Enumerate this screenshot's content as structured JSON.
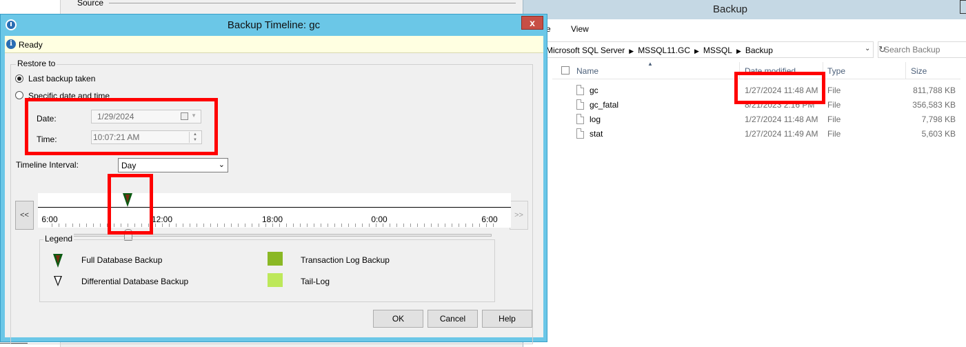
{
  "background_window": {
    "source_label": "Source"
  },
  "explorer": {
    "title": "Backup",
    "ribbon": {
      "partial_tab": "e",
      "view_tab": "View"
    },
    "breadcrumbs": [
      "Microsoft SQL Server",
      "MSSQL11.GC",
      "MSSQL",
      "Backup"
    ],
    "search_placeholder": "Search Backup",
    "columns": {
      "name": "Name",
      "date": "Date modified",
      "type": "Type",
      "size": "Size"
    },
    "files": [
      {
        "name": "gc",
        "date": "1/27/2024 11:48 AM",
        "type": "File",
        "size": "811,788 KB"
      },
      {
        "name": "gc_fatal",
        "date": "8/21/2023 2:16 PM",
        "type": "File",
        "size": "356,583 KB"
      },
      {
        "name": "log",
        "date": "1/27/2024 11:48 AM",
        "type": "File",
        "size": "7,798 KB"
      },
      {
        "name": "stat",
        "date": "1/27/2024 11:49 AM",
        "type": "File",
        "size": "5,603 KB"
      }
    ]
  },
  "dialog": {
    "title": "Backup Timeline: gc",
    "close_label": "x",
    "status": "Ready",
    "restore_to": {
      "label": "Restore to",
      "option_last": "Last backup taken",
      "option_specific": "Specific date and time",
      "selected": "last",
      "date_label": "Date:",
      "date_value": "1/29/2024",
      "time_label": "Time:",
      "time_value": "10:07:21 AM"
    },
    "interval": {
      "label": "Timeline Interval:",
      "value": "Day"
    },
    "timeline": {
      "prev_label": "<<",
      "next_label": ">>",
      "tick_labels": [
        "6:00",
        "12:00",
        "18:00",
        "0:00",
        "6:00"
      ]
    },
    "legend": {
      "title": "Legend",
      "full": "Full Database Backup",
      "differential": "Differential Database Backup",
      "transaction_log": "Transaction Log Backup",
      "tail_log": "Tail-Log"
    },
    "buttons": {
      "ok": "OK",
      "cancel": "Cancel",
      "help": "Help"
    }
  },
  "colors": {
    "dialog_titlebar": "#6bc7e7",
    "status_bar": "#ffffe1",
    "highlight_box": "#ff0000",
    "full_backup_marker": "#0b5a12",
    "transaction_log_swatch": "#8ab825",
    "tail_log_swatch": "#bde85a"
  }
}
